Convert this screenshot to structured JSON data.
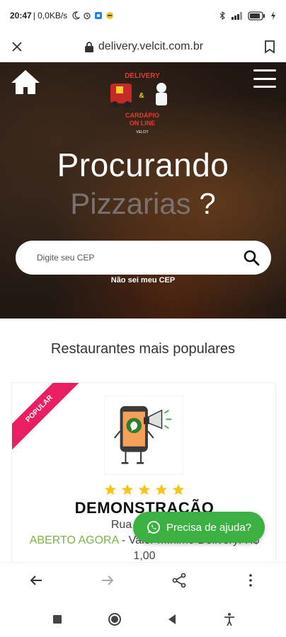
{
  "status_bar": {
    "time": "20:47",
    "network": "| 0,0KB/s"
  },
  "browser": {
    "url": "delivery.velcit.com.br"
  },
  "hero": {
    "title_line1": "Procurando",
    "title_highlight": "Pizzarias",
    "title_question": " ?",
    "cep_placeholder": "Digite seu CEP",
    "no_cep_link": "Não sei meu CEP",
    "logo": {
      "line1": "DELIVERY",
      "amp": "&",
      "line2": "CARDÁPIO",
      "line3": "ON LINE",
      "brand": "VELCIT"
    }
  },
  "section": {
    "title": "Restaurantes mais populares"
  },
  "restaurant": {
    "badge": "POPULAR",
    "rating": 5,
    "name": "DEMONSTRAÇÃO",
    "address": "Rua Rua Ves",
    "status": "ABERTO AGORA",
    "min_order": " - Valor Mínimo Delivery: R$",
    "min_value": "1,00"
  },
  "help_button": {
    "label": "Precisa de ajuda?"
  },
  "colors": {
    "accent_green": "#3cb043",
    "open_green": "#7cb342",
    "star": "#f5c518",
    "ribbon": "#e91e63"
  },
  "icons": [
    "close-icon",
    "lock-icon",
    "bookmark-icon",
    "home-icon",
    "hamburger-menu-icon",
    "search-icon",
    "star-icon",
    "whatsapp-icon",
    "back-arrow-icon",
    "forward-arrow-icon",
    "share-icon",
    "more-vert-icon",
    "square-icon",
    "circle-icon",
    "triangle-back-icon",
    "accessibility-icon"
  ]
}
